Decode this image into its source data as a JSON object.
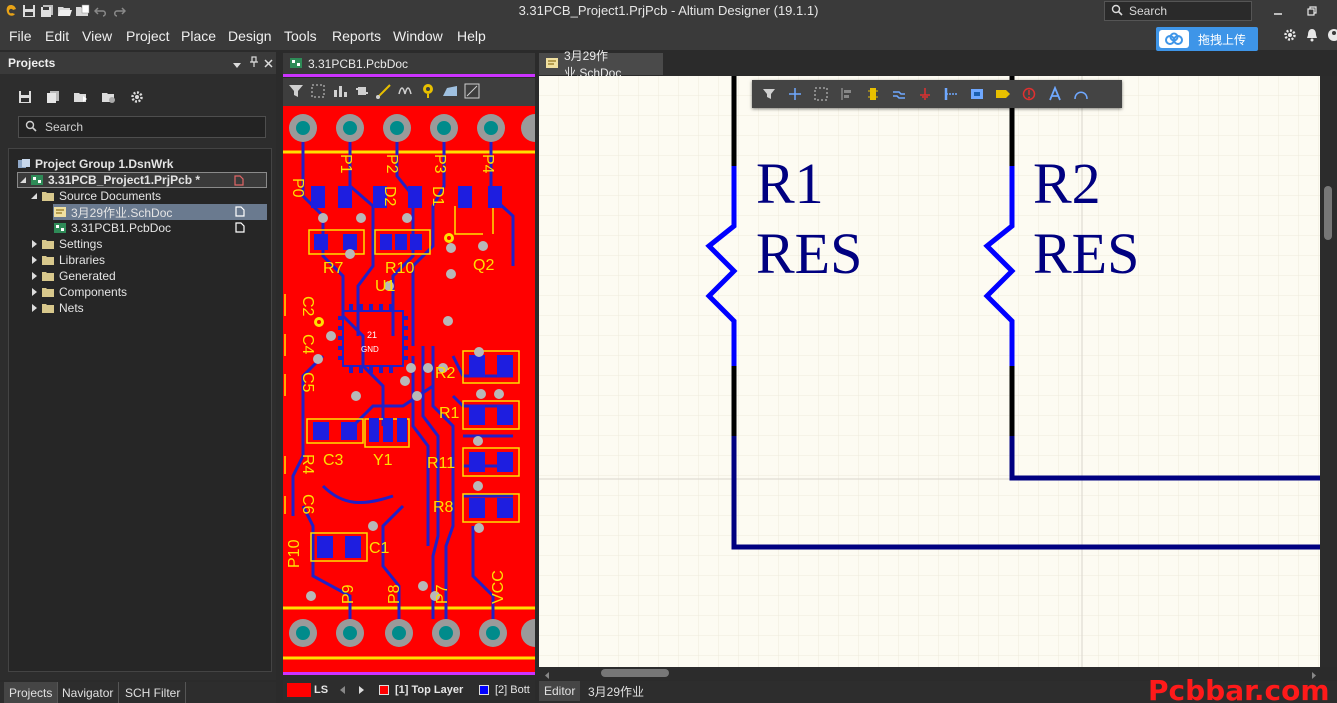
{
  "window": {
    "title": "3.31PCB_Project1.PrjPcb - Altium Designer (19.1.1)",
    "search_placeholder": "Search"
  },
  "menu": [
    "File",
    "Edit",
    "View",
    "Project",
    "Place",
    "Design",
    "Tools",
    "Reports",
    "Window",
    "Help"
  ],
  "upload_button": "拖拽上传",
  "projects_panel": {
    "title": "Projects",
    "search_placeholder": "Search",
    "tree": {
      "group": "Project Group 1.DsnWrk",
      "project": "3.31PCB_Project1.PrjPcb *",
      "source_documents": "Source Documents",
      "sch_doc": "3月29作业.SchDoc",
      "pcb_doc": "3.31PCB1.PcbDoc",
      "settings": "Settings",
      "libraries": "Libraries",
      "generated": "Generated",
      "components": "Components",
      "nets": "Nets"
    },
    "bottom_tabs": [
      "Projects",
      "Navigator",
      "SCH Filter"
    ]
  },
  "doc_tabs": {
    "pcb": "3.31PCB1.PcbDoc",
    "sch": "3月29作业.SchDoc"
  },
  "pcb_labels": {
    "designators": [
      "P0",
      "P1",
      "P2",
      "P3",
      "P4",
      "D2",
      "D1",
      "R7",
      "R10",
      "Q2",
      "U1",
      "C2",
      "C4",
      "C5",
      "R2",
      "R1",
      "R11",
      "R8",
      "C3",
      "Y1",
      "R4",
      "C6",
      "C1",
      "P10",
      "P9",
      "P8",
      "P7",
      "VCC"
    ],
    "u1_pin_text": "21",
    "u1_gnd_text": "GND"
  },
  "pcb_status": {
    "layer_set": "LS",
    "top_layer": "[1] Top Layer",
    "bottom_layer": "[2] Bott",
    "top_layer_color": "#ff0000",
    "bottom_layer_color": "#0000ff"
  },
  "schematic": {
    "r1_designator": "R1",
    "r1_comment": "RES",
    "r2_designator": "R2",
    "r2_comment": "RES",
    "wire_color": "#000080",
    "resistor_color": "#0000ff"
  },
  "status_tabs": [
    "Editor",
    "3月29作业"
  ],
  "watermark": "Pcbbar.com"
}
